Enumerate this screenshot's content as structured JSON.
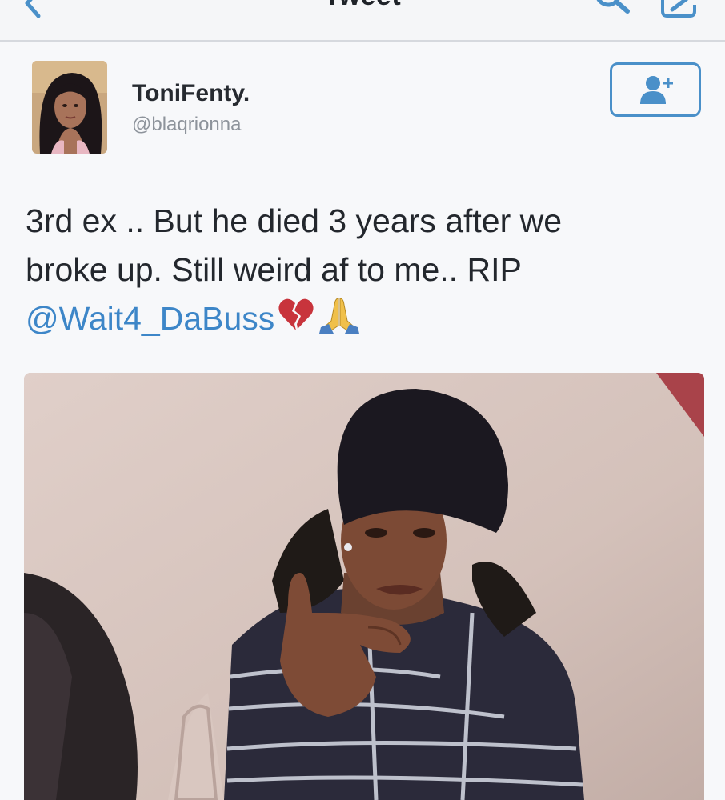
{
  "nav": {
    "title": "Tweet",
    "back_icon": "chevron-left-icon",
    "search_icon": "search-icon",
    "compose_icon": "compose-icon"
  },
  "author": {
    "display_name": "ToniFenty.",
    "handle": "@blaqrionna",
    "follow_icon": "add-user-icon"
  },
  "tweet": {
    "text_line1": "3rd ex .. But he died 3 years after we",
    "text_line2": "broke up. Still weird af to me.. RIP",
    "mention": "@Wait4_DaBuss",
    "emoji": [
      "broken-heart-emoji",
      "praying-hands-emoji"
    ]
  },
  "colors": {
    "accent": "#3d86c8",
    "follow_border": "#4a90c9",
    "text": "#23272d",
    "handle": "#8d939b"
  }
}
